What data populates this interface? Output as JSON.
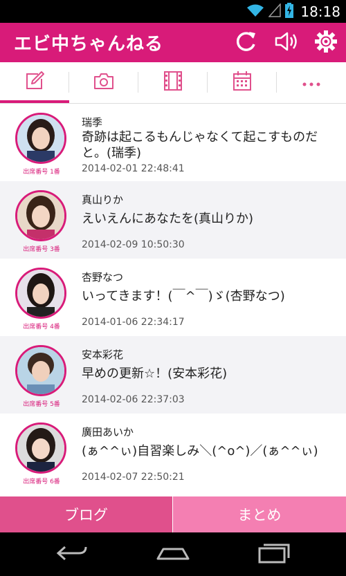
{
  "status_bar": {
    "time": "18:18",
    "icons": [
      "wifi-icon",
      "signal-icon",
      "battery-charging-icon"
    ]
  },
  "app_bar": {
    "title": "エビ中ちゃんねる",
    "actions": [
      "refresh-icon",
      "speaker-icon",
      "settings-gear-icon"
    ]
  },
  "tabs": [
    {
      "icon": "edit-icon",
      "selected": true
    },
    {
      "icon": "camera-icon",
      "selected": false
    },
    {
      "icon": "film-icon",
      "selected": false
    },
    {
      "icon": "calendar-icon",
      "selected": false
    },
    {
      "icon": "more-dots-icon",
      "selected": false
    }
  ],
  "colors": {
    "brand": "#d81b79",
    "button_left": "#e0508c",
    "button_right": "#f47fb2",
    "row_alt": "#f3f3f6"
  },
  "posts": [
    {
      "name": "瑞季",
      "seat": "出席番号 1番",
      "body": "奇跡は起こるもんじゃなくて起こすものだと。(瑞季)",
      "date": "2014-02-01 22:48:41"
    },
    {
      "name": "真山りか",
      "seat": "出席番号 3番",
      "body": "えいえんにあなたを(真山りか)",
      "date": "2014-02-09 10:50:30"
    },
    {
      "name": "杏野なつ",
      "seat": "出席番号 4番",
      "body": "いってきます！(￣^￣)ゞ(杏野なつ)",
      "date": "2014-01-06 22:34:17"
    },
    {
      "name": "安本彩花",
      "seat": "出席番号 5番",
      "body": "早めの更新☆！(安本彩花)",
      "date": "2014-02-06 22:37:03"
    },
    {
      "name": "廣田あいか",
      "seat": "出席番号 6番",
      "body": "(ぁ^^ぃ)自習楽しみ＼(^o^)／(ぁ^^ぃ)",
      "date": "2014-02-07 22:50:21"
    }
  ],
  "bottom_buttons": {
    "left": "ブログ",
    "right": "まとめ"
  },
  "nav_bar": [
    "back-icon",
    "home-icon",
    "recent-apps-icon"
  ]
}
